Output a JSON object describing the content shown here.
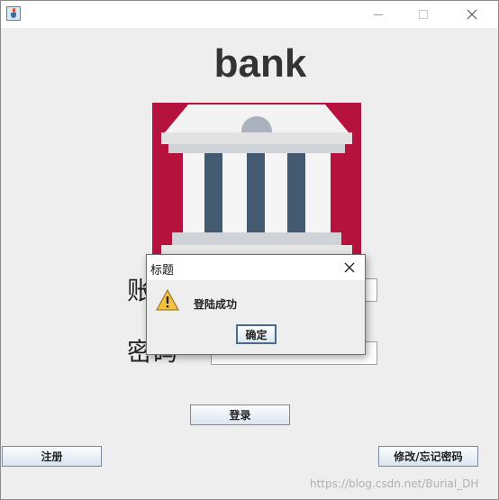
{
  "app": {
    "title": "bank"
  },
  "form": {
    "account_label": "账户",
    "password_label": "密码",
    "account_value": "",
    "password_value": "••••••",
    "login_label": "登录",
    "register_label": "注册",
    "reset_label": "修改/忘记密码"
  },
  "dialog": {
    "title": "标题",
    "message": "登陆成功",
    "ok_label": "确定",
    "icon": "warning-icon"
  },
  "watermark": {
    "text": "https://blog.csdn.net/Burial_DH"
  },
  "icons": {
    "app": "java-cup-icon",
    "minimize": "minimize-icon",
    "maximize": "maximize-icon",
    "close": "close-icon",
    "logo": "bank-building-icon"
  },
  "colors": {
    "logo_background": "#b5123e",
    "window_background": "#eeeeee"
  }
}
